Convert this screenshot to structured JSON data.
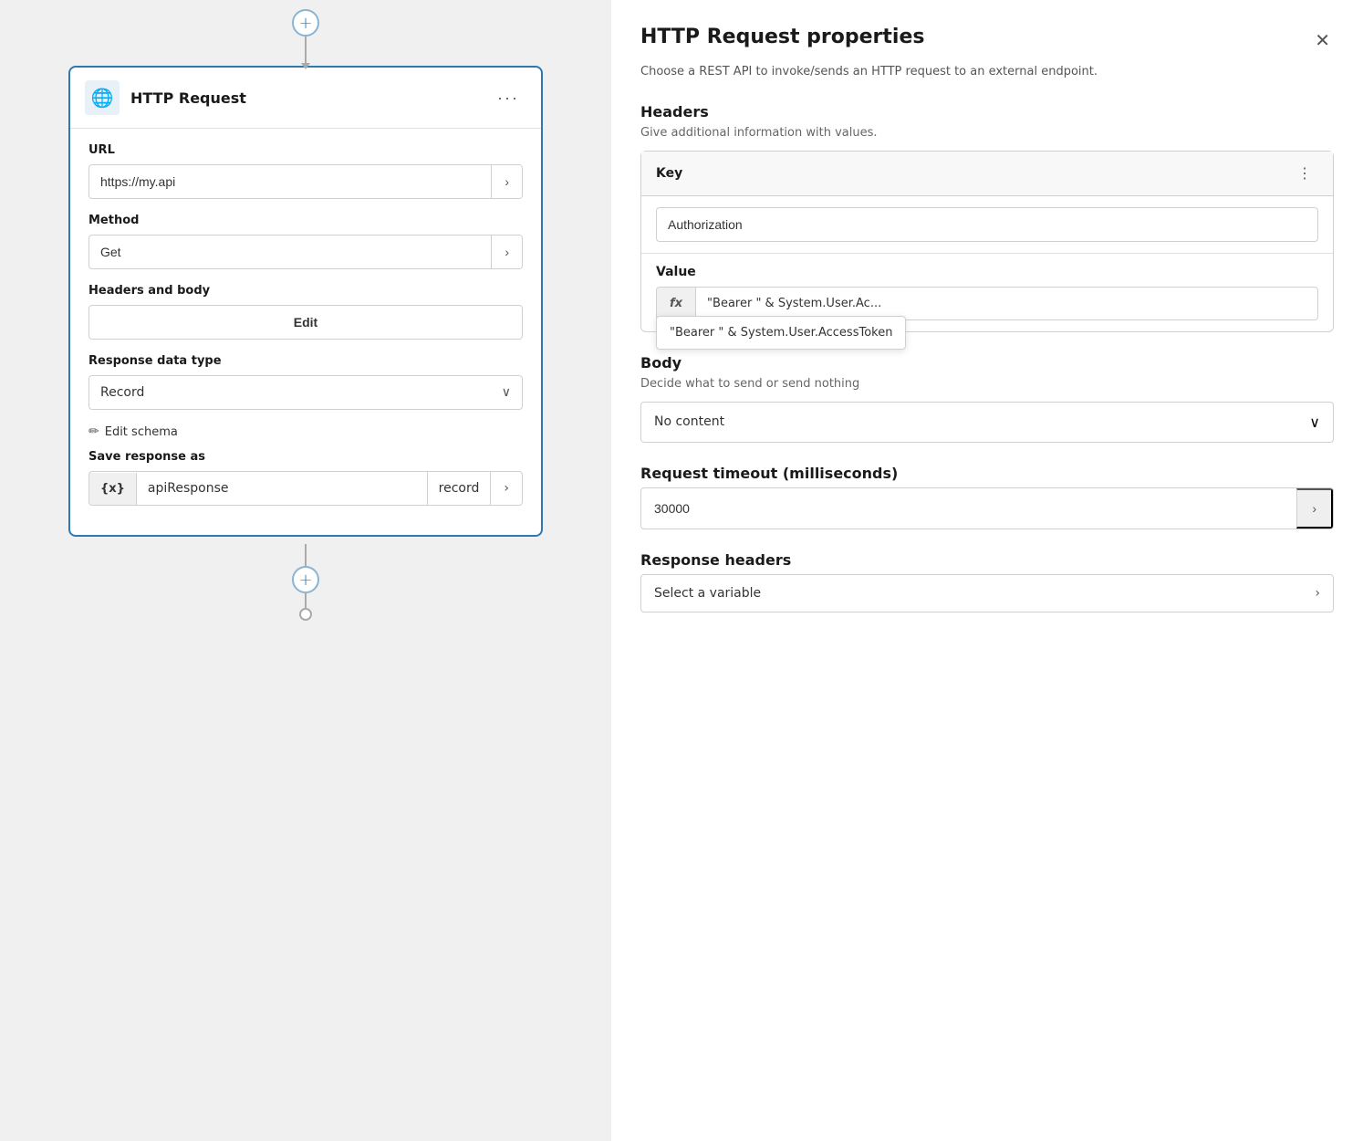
{
  "left": {
    "connector_top_plus": "+",
    "card": {
      "title": "HTTP Request",
      "more_icon": "···",
      "icon": "🌐",
      "url_label": "URL",
      "url_value": "https://my.api",
      "method_label": "Method",
      "method_value": "Get",
      "headers_body_label": "Headers and body",
      "headers_body_btn": "Edit",
      "response_data_label": "Response data type",
      "response_data_value": "Record",
      "edit_schema_label": "Edit schema",
      "save_response_label": "Save response as",
      "save_response_badge": "{x}",
      "save_response_name": "apiResponse",
      "save_response_type": "record"
    },
    "connector_bottom_plus": "+"
  },
  "right": {
    "title": "HTTP Request properties",
    "close_icon": "✕",
    "description": "Choose a REST API to invoke/sends an HTTP request to an external endpoint.",
    "headers_section": {
      "title": "Headers",
      "subtitle": "Give additional information with values.",
      "key_col_label": "Key",
      "three_dots": "⋮",
      "key_value": "Authorization",
      "value_label": "Value",
      "fx_badge": "fx",
      "fx_value": "\"Bearer \" & System.User.Ac...",
      "tooltip_text": "\"Bearer \" & System.User.AccessToken"
    },
    "body_section": {
      "title": "Body",
      "subtitle": "Decide what to send or send nothing",
      "select_value": "No content"
    },
    "timeout_section": {
      "title": "Request timeout (milliseconds)",
      "value": "30000"
    },
    "response_headers_section": {
      "title": "Response headers",
      "placeholder": "Select a variable"
    }
  }
}
